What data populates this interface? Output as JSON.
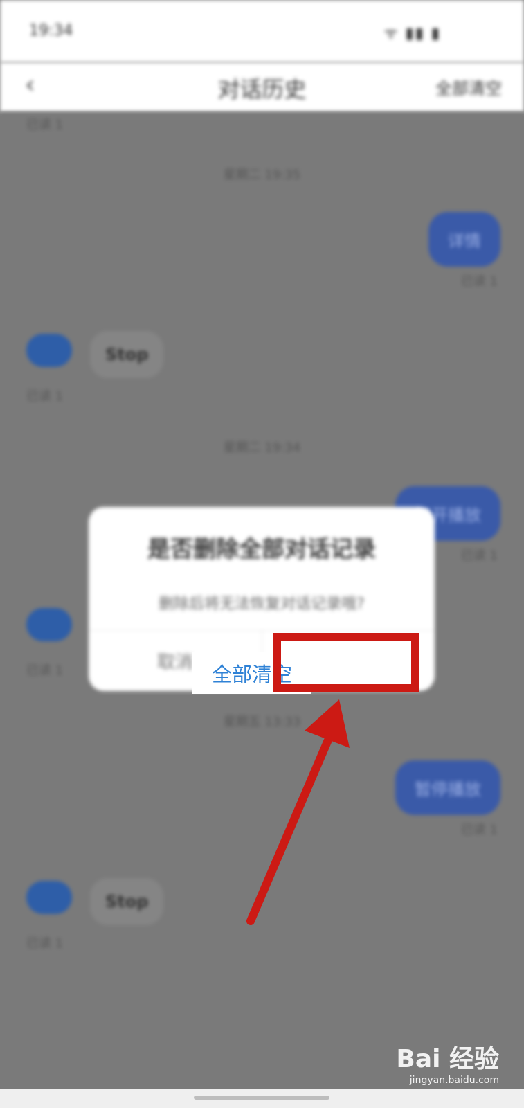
{
  "status_bar": {
    "time": "19:34",
    "icons": "ᯤ ▮▮ ▮"
  },
  "nav": {
    "back_icon": "chevron-left-icon",
    "back_glyph": "‹",
    "title": "对话历史",
    "clear_all": "全部清空"
  },
  "chat": {
    "timestamps": [
      "星期二 19:35",
      "星期二 19:34",
      "星期五 13:33"
    ],
    "user_messages": [
      {
        "text": "详情",
        "read": "已读 1"
      },
      {
        "text": "打开播放",
        "read": "已读 1"
      },
      {
        "text": "暂停播放",
        "read": "已读 1"
      }
    ],
    "bot_messages": [
      {
        "text": "Stop",
        "meta": "已读 1"
      },
      {
        "text": "",
        "meta": "已读 1"
      },
      {
        "text": "Stop",
        "meta": "已读 1"
      }
    ],
    "top_meta": "已读 1"
  },
  "dialog": {
    "title": "是否删除全部对话记录",
    "message": "删除后将无法恢复对话记录哦?",
    "cancel": "取消",
    "confirm": "全部清空"
  },
  "annotation": {
    "box_color": "#cc1a14",
    "arrow_color": "#cc1a14"
  },
  "watermark": {
    "main": "Bai 经验",
    "sub": "jingyan.baidu.com"
  }
}
